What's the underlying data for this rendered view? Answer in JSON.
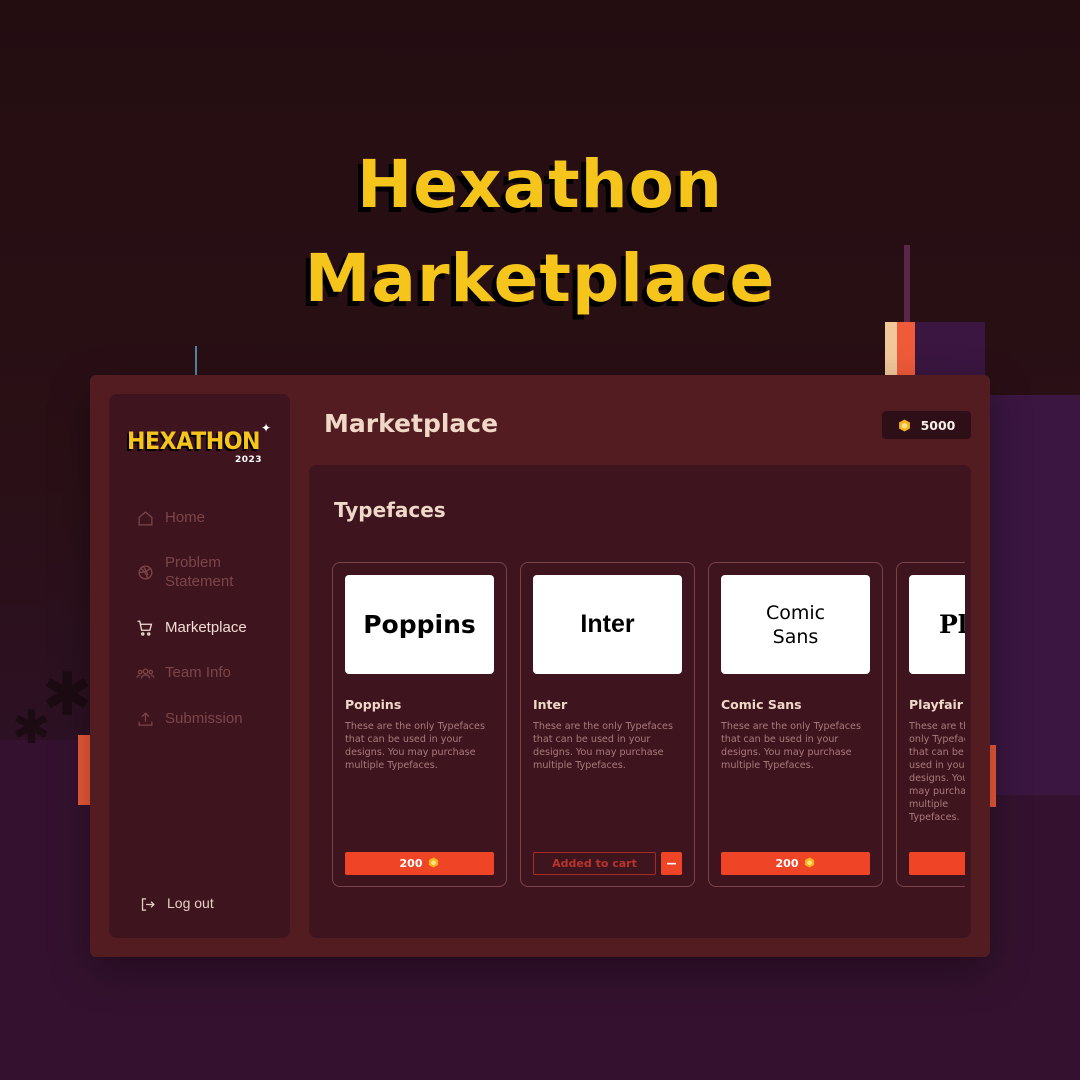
{
  "headline": {
    "line1": "Hexathon",
    "line2": "Marketplace"
  },
  "colors": {
    "accent_yellow": "#f5c51b",
    "button_orange": "#f04427",
    "panel_dark": "#3e141f",
    "window": "#521c20",
    "text_light": "#f0d8c8",
    "text_muted": "#7c4649"
  },
  "sidebar": {
    "logo": {
      "text": "HEXATHON",
      "year": "2023"
    },
    "items": [
      {
        "label": "Home",
        "icon": "home-icon",
        "active": false
      },
      {
        "label": "Problem Statement",
        "icon": "dribbble-icon",
        "active": false
      },
      {
        "label": "Marketplace",
        "icon": "cart-icon",
        "active": true
      },
      {
        "label": "Team Info",
        "icon": "team-icon",
        "active": false
      },
      {
        "label": "Submission",
        "icon": "upload-icon",
        "active": false
      }
    ],
    "logout": {
      "label": "Log out",
      "icon": "logout-icon"
    }
  },
  "header": {
    "title": "Marketplace",
    "balance": "5000",
    "balance_icon": "coin-icon"
  },
  "main": {
    "section_title": "Typefaces",
    "cards": [
      {
        "preview_text": "Poppins",
        "name": "Poppins",
        "description": "These are the only Typefaces that can be used in your designs. You may purchase multiple Typefaces.",
        "status": "buy",
        "price": "200"
      },
      {
        "preview_text": "Inter",
        "name": "Inter",
        "description": "These are the only Typefaces that can be used in your designs. You may purchase multiple Typefaces.",
        "status": "added",
        "added_label": "Added to cart",
        "remove_label": "−"
      },
      {
        "preview_text": "Comic\nSans",
        "name": "Comic Sans",
        "description": "These are the only Typefaces that can be used in your designs. You may purchase multiple Typefaces.",
        "status": "buy",
        "price": "200"
      },
      {
        "preview_text": "Pl",
        "name": "Playfair",
        "description": "These are the only Typefaces that can be used in your designs. You may purchase multiple Typefaces.",
        "status": "buy",
        "price": ""
      }
    ]
  }
}
